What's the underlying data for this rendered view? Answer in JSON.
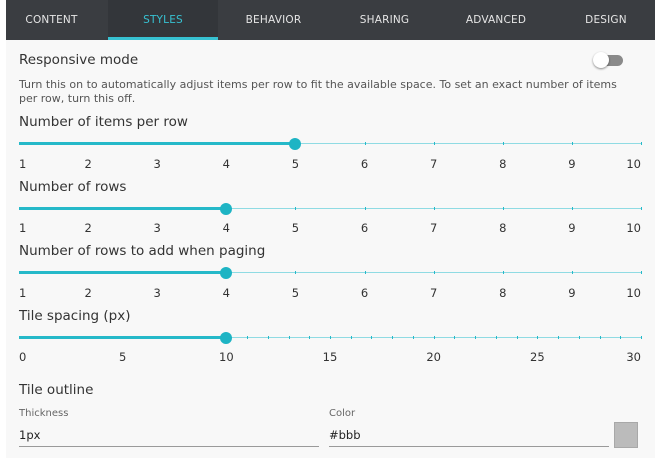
{
  "tabs": [
    {
      "label": "CONTENT",
      "active": false
    },
    {
      "label": "STYLES",
      "active": true
    },
    {
      "label": "BEHAVIOR",
      "active": false
    },
    {
      "label": "SHARING",
      "active": false
    },
    {
      "label": "ADVANCED",
      "active": false
    },
    {
      "label": "DESIGN",
      "active": false
    }
  ],
  "responsive": {
    "label": "Responsive mode",
    "enabled": false,
    "description": "Turn this on to automatically adjust items per row to fit the available space. To set an exact number of items per row, turn this off."
  },
  "sliders": [
    {
      "label": "Number of items per row",
      "min": 1,
      "max": 10,
      "step": 1,
      "value": 5,
      "scale": [
        "1",
        "2",
        "3",
        "4",
        "5",
        "6",
        "7",
        "8",
        "9",
        "10"
      ]
    },
    {
      "label": "Number of rows",
      "min": 1,
      "max": 10,
      "step": 1,
      "value": 4,
      "scale": [
        "1",
        "2",
        "3",
        "4",
        "5",
        "6",
        "7",
        "8",
        "9",
        "10"
      ]
    },
    {
      "label": "Number of rows to add when paging",
      "min": 1,
      "max": 10,
      "step": 1,
      "value": 4,
      "scale": [
        "1",
        "2",
        "3",
        "4",
        "5",
        "6",
        "7",
        "8",
        "9",
        "10"
      ]
    },
    {
      "label": "Tile spacing (px)",
      "min": 0,
      "max": 30,
      "step": 1,
      "value": 10,
      "scale": [
        "0",
        "5",
        "10",
        "15",
        "20",
        "25",
        "30"
      ]
    }
  ],
  "outline": {
    "title": "Tile outline",
    "thickness_label": "Thickness",
    "thickness_value": "1px",
    "color_label": "Color",
    "color_value": "#bbb",
    "swatch_color": "#bbbbbb"
  },
  "colors": {
    "accent": "#25b9c9",
    "tabbar": "#3a3d41"
  }
}
